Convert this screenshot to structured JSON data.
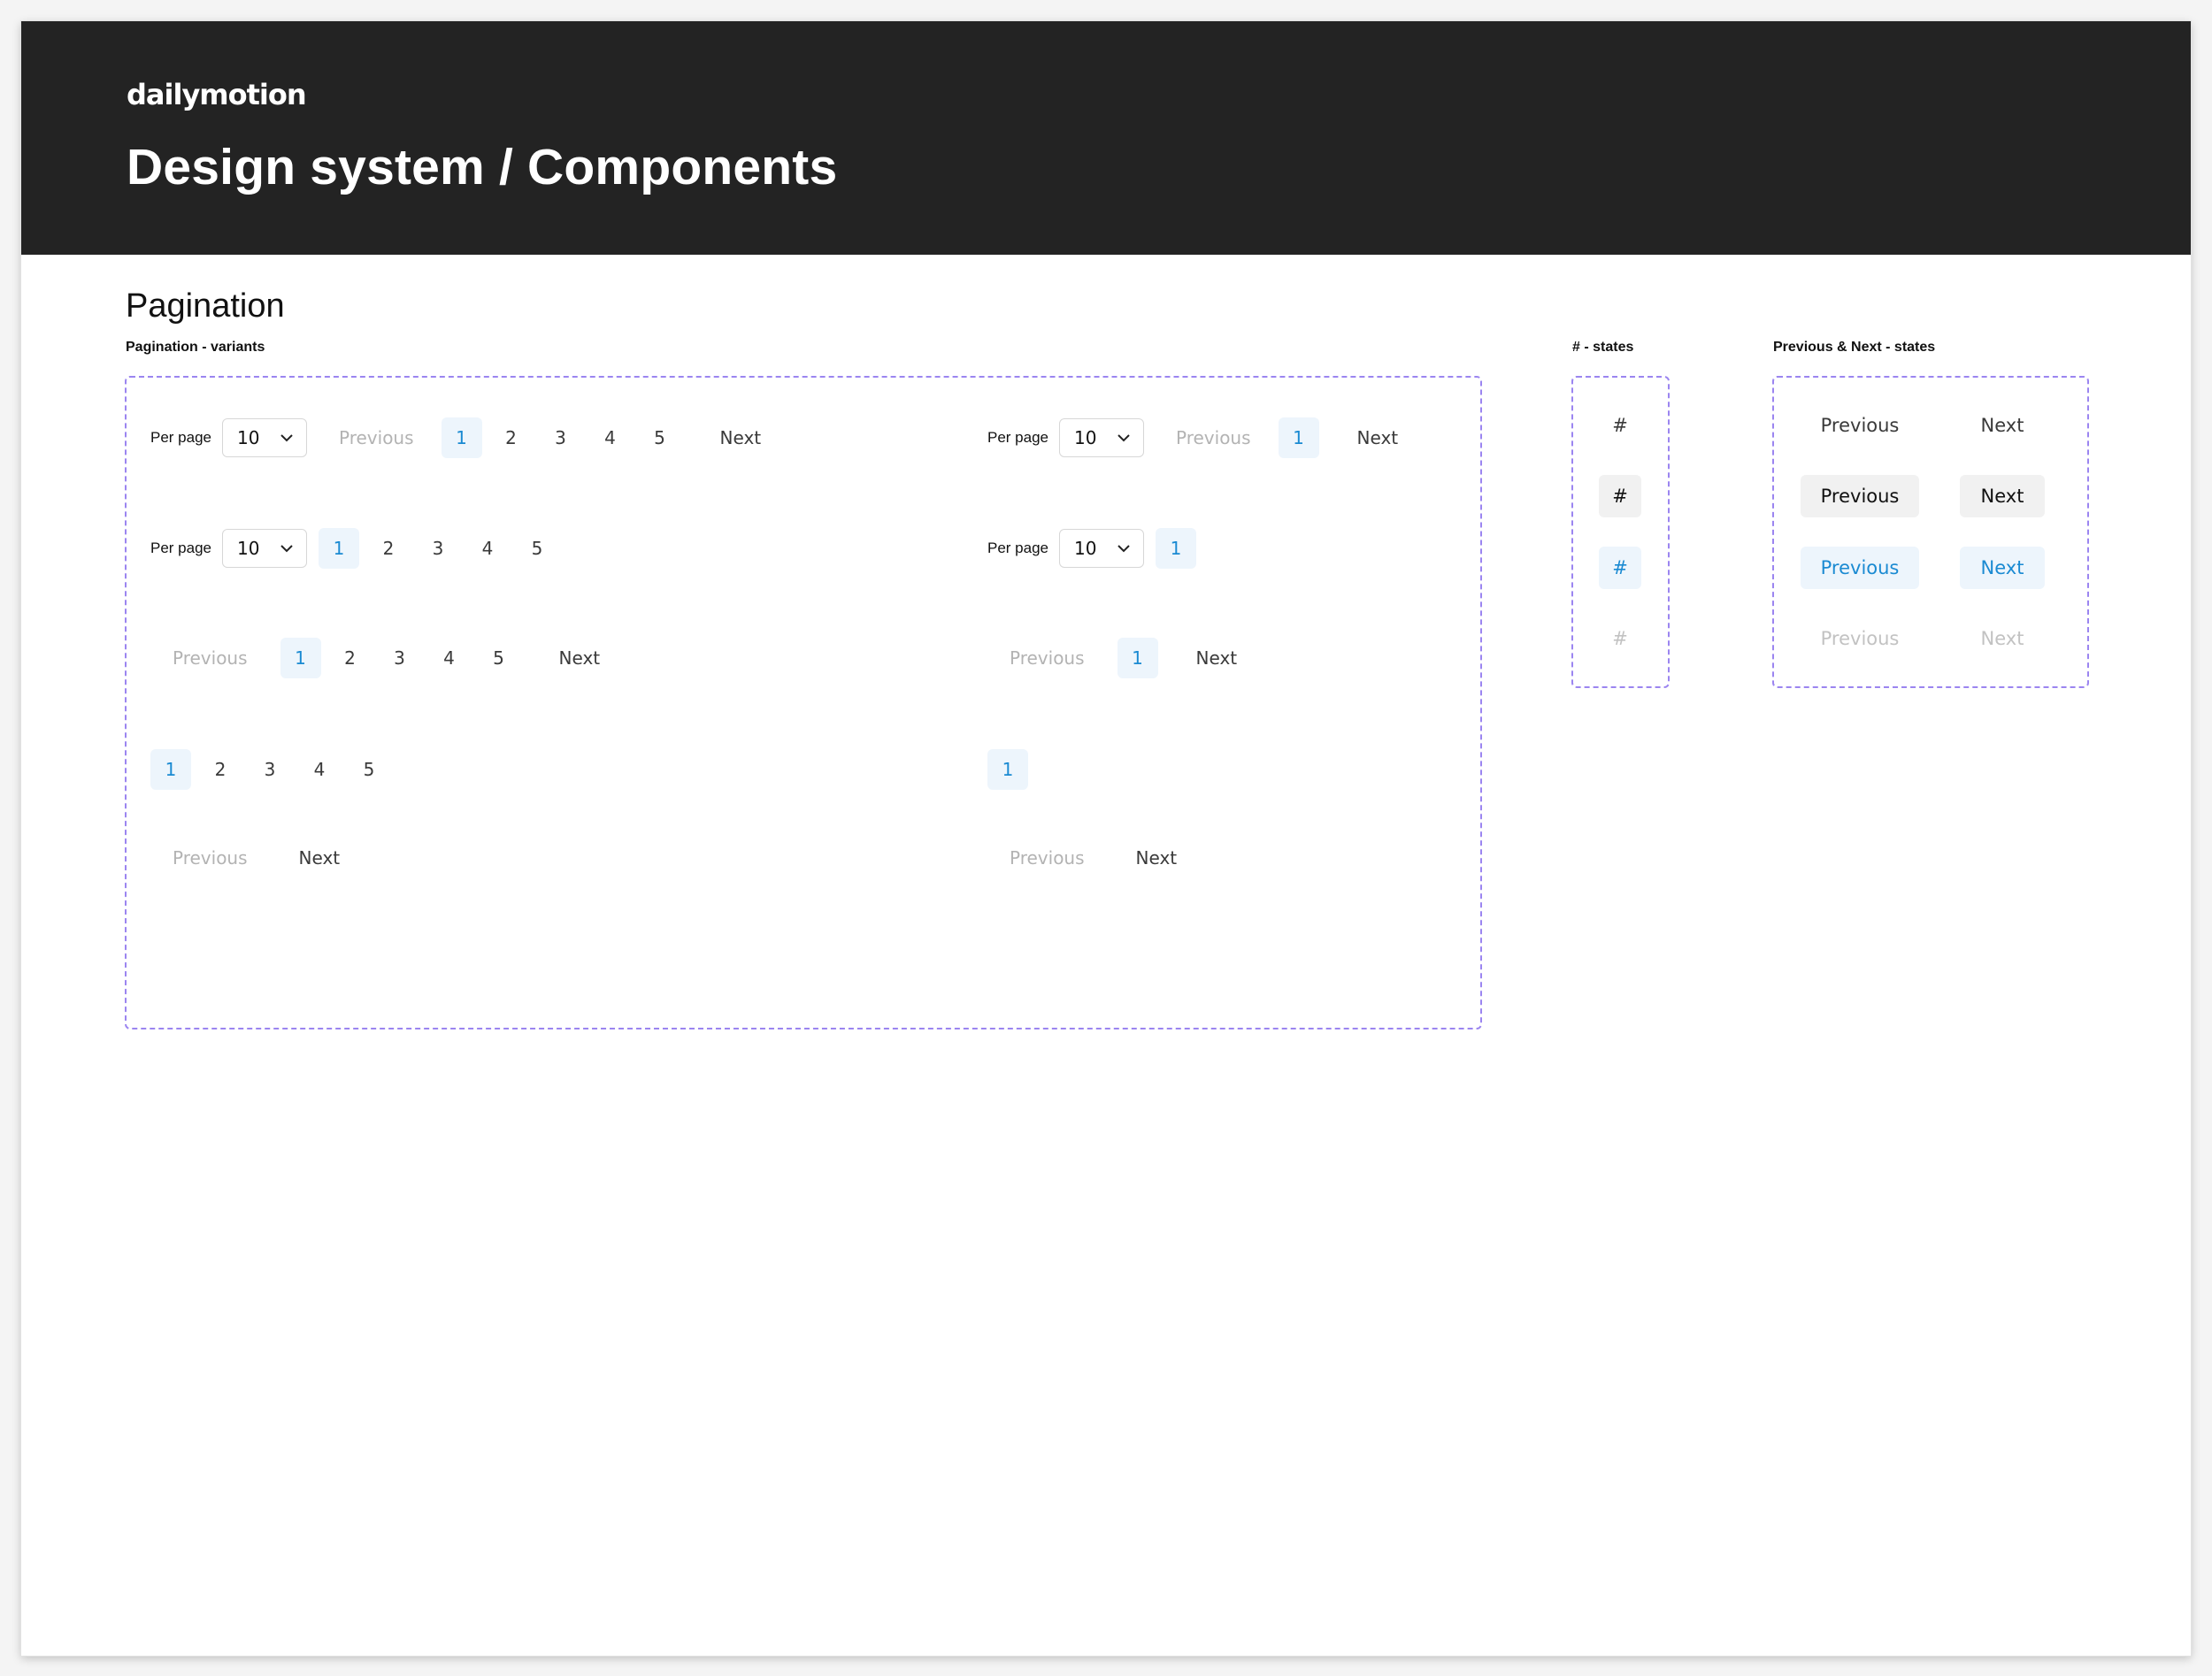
{
  "header": {
    "logo": "dailymotion",
    "title": "Design system / Components"
  },
  "section": {
    "title": "Pagination",
    "variants_label": "Pagination - variants",
    "hash_states_label": "# - states",
    "prevnext_states_label": "Previous & Next - states"
  },
  "labels": {
    "per_page": "Per page",
    "per_page_value": "10",
    "previous": "Previous",
    "next": "Next",
    "hash": "#"
  },
  "pages": [
    "1",
    "2",
    "3",
    "4",
    "5"
  ],
  "single_page": "1",
  "active_page": "1",
  "states": [
    "default",
    "hover",
    "active",
    "disabled"
  ],
  "colors": {
    "header_bg": "#232323",
    "accent": "#1a8ad2",
    "active_bg": "#edf5fc",
    "hover_bg": "#f1f1f1",
    "disabled_text": "#b3b3b3",
    "dashed_border": "#9b85f0"
  }
}
